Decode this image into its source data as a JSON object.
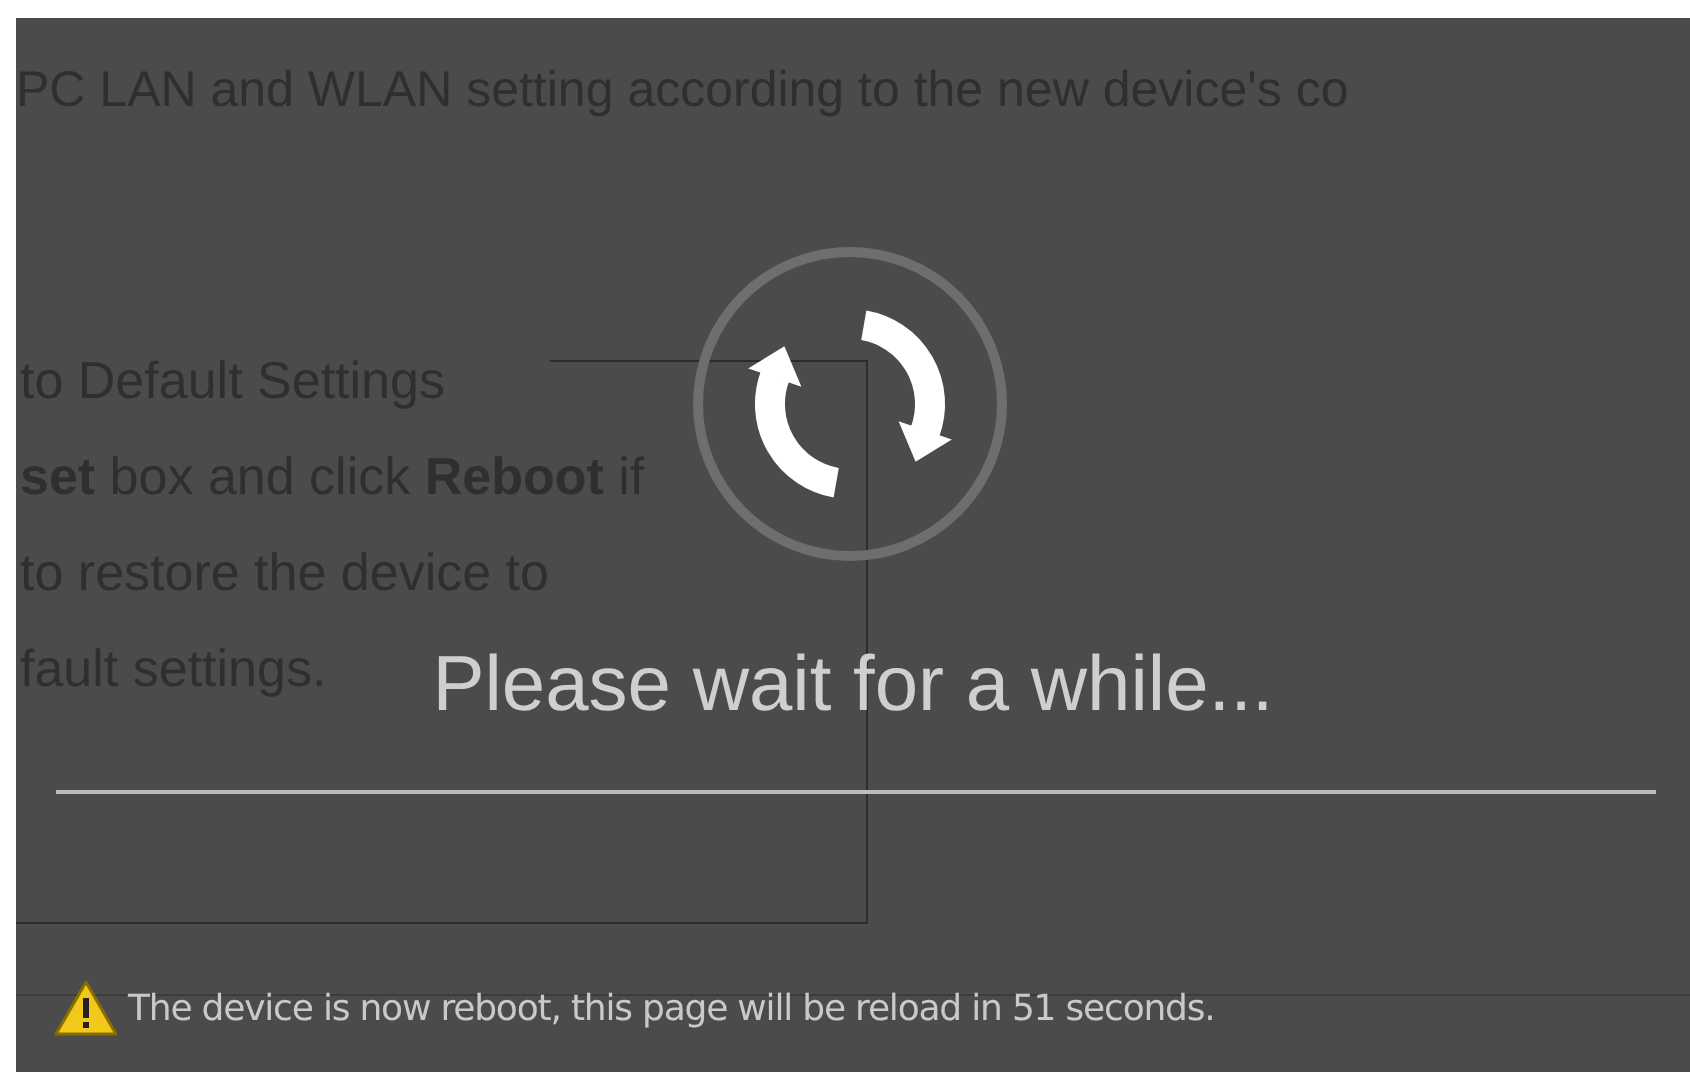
{
  "page": {
    "intro": "PC LAN and WLAN setting according to the new device's co",
    "reset_title": "to Default Settings",
    "reset_lines": [
      "**set** box and click **Reboot** if",
      "to restore the device to",
      "fault settings."
    ]
  },
  "overlay": {
    "message": "Please wait for a while...",
    "notice": "The device is now reboot, this page will be reload in 51 seconds."
  }
}
